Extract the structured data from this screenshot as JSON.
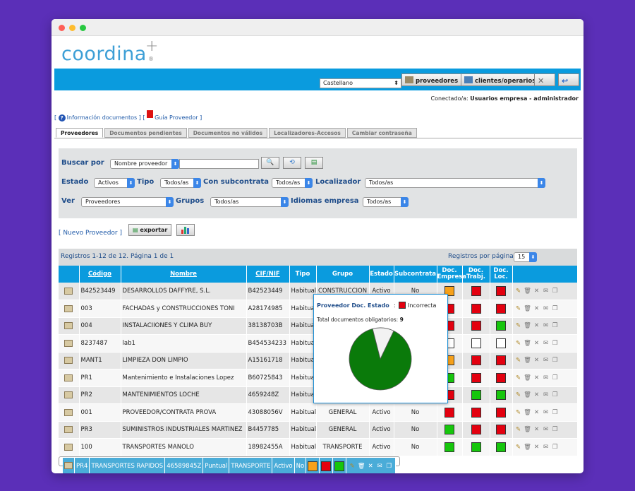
{
  "app": {
    "brand": "coordina",
    "plus": "+",
    "reg": "®"
  },
  "topbar": {
    "language": "Castellano",
    "btn_proveedores": "proveedores",
    "btn_clientes": "clientes/operarios"
  },
  "connected": {
    "label": "Conectado/a:",
    "user": "Usuarios empresa - administrador"
  },
  "links": {
    "info": "Información documentos",
    "guia": "Guía Proveedor"
  },
  "tabs": [
    "Proveedores",
    "Documentos pendientes",
    "Documentos no válidos",
    "Localizadores-Accesos",
    "Cambiar contraseña"
  ],
  "filters": {
    "buscar_label": "Buscar por",
    "buscar_value": "Nombre proveedor",
    "estado_label": "Estado",
    "estado_value": "Activos",
    "tipo_label": "Tipo",
    "tipo_value": "Todos/as",
    "subcontrata_label": "Con subcontrata",
    "subcontrata_value": "Todos/as",
    "localizador_label": "Localizador",
    "localizador_value": "Todos/as",
    "ver_label": "Ver",
    "ver_value": "Proveedores",
    "grupos_label": "Grupos",
    "grupos_value": "Todos/as",
    "idiomas_label": "Idiomas empresa",
    "idiomas_value": "Todos/as"
  },
  "actions": {
    "nuevo": "[ Nuevo Proveedor ]",
    "exportar": "exportar"
  },
  "registros": {
    "summary": "Registros 1-12 de 12. Página 1 de 1",
    "per_page_label": "Registros por página",
    "per_page_value": "15"
  },
  "table": {
    "headers": [
      "",
      "Código",
      "Nombre",
      "CIF/NIF",
      "Tipo",
      "Grupo",
      "Estado",
      "Subcontrata",
      "Doc. Empresa",
      "Doc. Trabj.",
      "Doc. Loc.",
      ""
    ],
    "rows": [
      {
        "codigo": "B42523449",
        "nombre": "DESARROLLOS DAFFYRE, S.L.",
        "cif": "B42523449",
        "tipo": "Habitual",
        "grupo": "CONSTRUCCION",
        "estado": "Activo",
        "sub": "No",
        "de": "orange",
        "dt": "red",
        "dl": "red"
      },
      {
        "codigo": "003",
        "nombre": "FACHADAS y CONSTRUCCIONES TONI",
        "cif": "A28174985",
        "tipo": "Habitual",
        "grupo": "",
        "estado": "",
        "sub": "",
        "de": "red",
        "dt": "red",
        "dl": "red"
      },
      {
        "codigo": "004",
        "nombre": "INSTALACIIONES Y CLIMA BUY",
        "cif": "38138703B",
        "tipo": "Habitual",
        "grupo": "",
        "estado": "",
        "sub": "",
        "de": "red",
        "dt": "red",
        "dl": "green"
      },
      {
        "codigo": "8237487",
        "nombre": "lab1",
        "cif": "B454534233",
        "tipo": "Habitual",
        "grupo": "",
        "estado": "",
        "sub": "",
        "de": "empty",
        "dt": "empty",
        "dl": "empty"
      },
      {
        "codigo": "MANT1",
        "nombre": "LIMPIEZA DON LIMPIO",
        "cif": "A15161718",
        "tipo": "Habitual",
        "grupo": "",
        "estado": "",
        "sub": "",
        "de": "orange",
        "dt": "red",
        "dl": "red"
      },
      {
        "codigo": "PR1",
        "nombre": "Mantenimiento e Instalaciones Lopez",
        "cif": "B60725843",
        "tipo": "Habitual",
        "grupo": "",
        "estado": "",
        "sub": "",
        "de": "green",
        "dt": "red",
        "dl": "red"
      },
      {
        "codigo": "PR2",
        "nombre": "MANTENIMIENTOS LOCHE",
        "cif": "4659248Z",
        "tipo": "Habitual",
        "grupo": "",
        "estado": "",
        "sub": "",
        "de": "red",
        "dt": "green",
        "dl": "green"
      },
      {
        "codigo": "001",
        "nombre": "PROVEEDOR/CONTRATA PROVA",
        "cif": "43088056V",
        "tipo": "Habitual",
        "grupo": "GENERAL",
        "estado": "Activo",
        "sub": "No",
        "de": "red",
        "dt": "red",
        "dl": "red"
      },
      {
        "codigo": "PR3",
        "nombre": "SUMINISTROS INDUSTRIALES MARTINEZ",
        "cif": "B4457785",
        "tipo": "Habitual",
        "grupo": "GENERAL",
        "estado": "Activo",
        "sub": "No",
        "de": "green",
        "dt": "red",
        "dl": "red"
      },
      {
        "codigo": "100",
        "nombre": "TRANSPORTES MANOLO",
        "cif": "18982455A",
        "tipo": "Habitual",
        "grupo": "TRANSPORTE",
        "estado": "Activo",
        "sub": "No",
        "de": "green",
        "dt": "green",
        "dl": "green"
      },
      {
        "codigo": "PR4",
        "nombre": "TRANSPORTES RAPIDOS",
        "cif": "46589845Z",
        "tipo": "Puntual",
        "grupo": "TRANSPORTE",
        "estado": "Activo",
        "sub": "No",
        "de": "orange",
        "dt": "red",
        "dl": "green"
      }
    ]
  },
  "popup": {
    "title": "Proveedor Doc. Estado",
    "sep": ":",
    "legend": "Incorrecta",
    "total_label": "Total documentos obligatorios:",
    "total_value": "9"
  },
  "chart_data": {
    "type": "pie",
    "slices": [
      {
        "label": "Incorrecta",
        "value": 8,
        "color": "#0a7a0a"
      },
      {
        "label": "",
        "value": 1,
        "color": "#f2f2f2"
      }
    ]
  },
  "colors": {
    "accent": "#0a9bde",
    "red": "#e3000f",
    "green": "#16c60c",
    "orange": "#f7a11a"
  }
}
